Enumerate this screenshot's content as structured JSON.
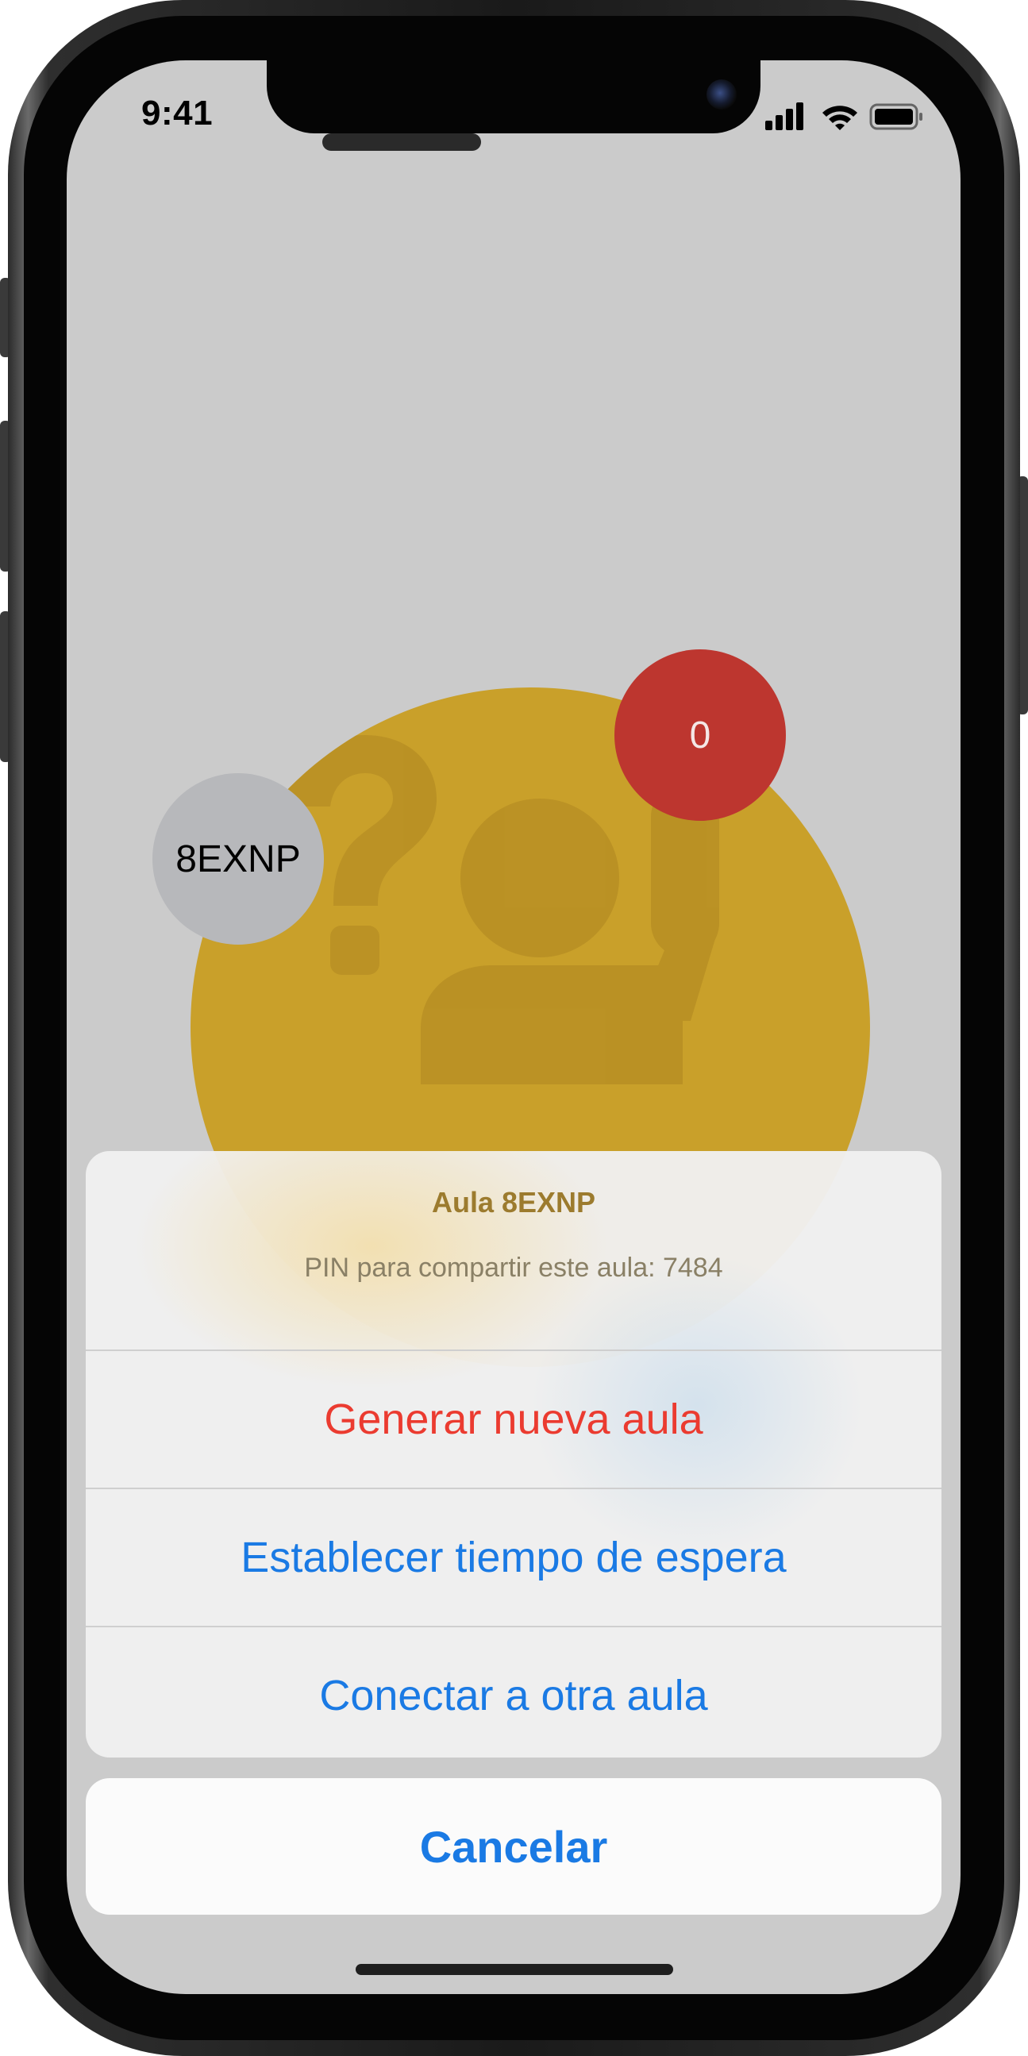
{
  "status_bar": {
    "time": "9:41"
  },
  "classroom": {
    "code_bubble": "8EXNP",
    "count_bubble": "0"
  },
  "action_sheet": {
    "title": "Aula 8EXNP",
    "message": "PIN para compartir este aula: 7484",
    "actions": [
      {
        "label": "Generar nueva aula",
        "style": "destructive"
      },
      {
        "label": "Establecer tiempo de espera",
        "style": "default"
      },
      {
        "label": "Conectar a otra aula",
        "style": "default"
      }
    ],
    "cancel_label": "Cancelar"
  },
  "colors": {
    "screen_bg": "#cbcbcb",
    "big_circle": "#c9a02a",
    "red_badge": "#bd362f",
    "gray_badge": "#b7b8bb",
    "action_blue": "#1a7ae4",
    "destructive_red": "#eb3b30"
  },
  "icons": [
    "question-mark-icon",
    "raised-hand-icon",
    "cellular-signal-icon",
    "wifi-icon",
    "battery-icon"
  ]
}
